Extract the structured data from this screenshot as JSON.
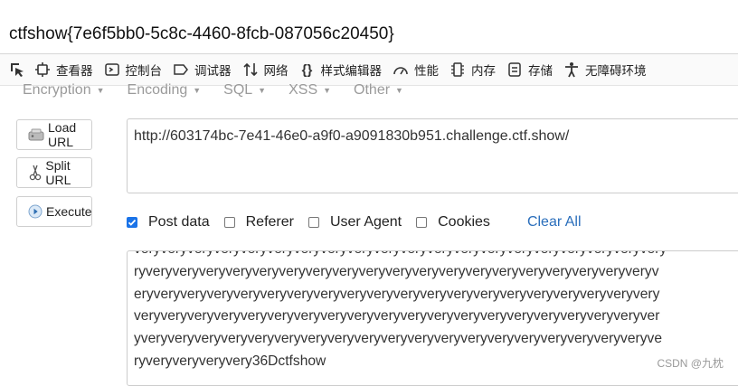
{
  "flag": "ctfshow{7e6f5bb0-5c8c-4460-8fcb-087056c20450}",
  "devtools": {
    "tabs": [
      {
        "icon": "inspector-icon",
        "label": "查看器"
      },
      {
        "icon": "console-icon",
        "label": "控制台"
      },
      {
        "icon": "debugger-icon",
        "label": "调试器"
      },
      {
        "icon": "network-icon",
        "label": "网络"
      },
      {
        "icon": "style-editor-icon",
        "label": "样式编辑器"
      },
      {
        "icon": "performance-icon",
        "label": "性能"
      },
      {
        "icon": "memory-icon",
        "label": "内存"
      },
      {
        "icon": "storage-icon",
        "label": "存储"
      },
      {
        "icon": "accessibility-icon",
        "label": "无障碍环境"
      }
    ]
  },
  "menu": {
    "items": [
      "Encryption",
      "Encoding",
      "SQL",
      "XSS",
      "Other"
    ]
  },
  "buttons": {
    "load_url": "Load URL",
    "split_url": "Split URL",
    "execute": "Execute"
  },
  "url": {
    "value": "http://603174bc-7e41-46e0-a9f0-a9091830b951.challenge.ctf.show/"
  },
  "options": {
    "post_data": {
      "label": "Post data",
      "checked": true
    },
    "referer": {
      "label": "Referer",
      "checked": false
    },
    "user_agent": {
      "label": "User Agent",
      "checked": false
    },
    "cookies": {
      "label": "Cookies",
      "checked": false
    },
    "clear_all": "Clear All"
  },
  "post_body": {
    "lines": [
      "veryveryveryveryveryveryveryveryveryveryveryveryveryveryveryveryveryveryveryvery",
      "ryveryveryveryveryveryveryveryveryveryveryveryveryveryveryveryveryveryveryveryv",
      "eryveryveryveryveryveryveryveryveryveryveryveryveryveryveryveryveryveryveryvery",
      "veryveryveryveryveryveryveryveryveryveryveryveryveryveryveryveryveryveryveryver",
      "yveryveryveryveryveryveryveryveryveryveryveryveryveryveryveryveryveryveryveryve",
      "ryveryveryveryvery36Dctfshow"
    ]
  },
  "watermark": "CSDN @九枕"
}
